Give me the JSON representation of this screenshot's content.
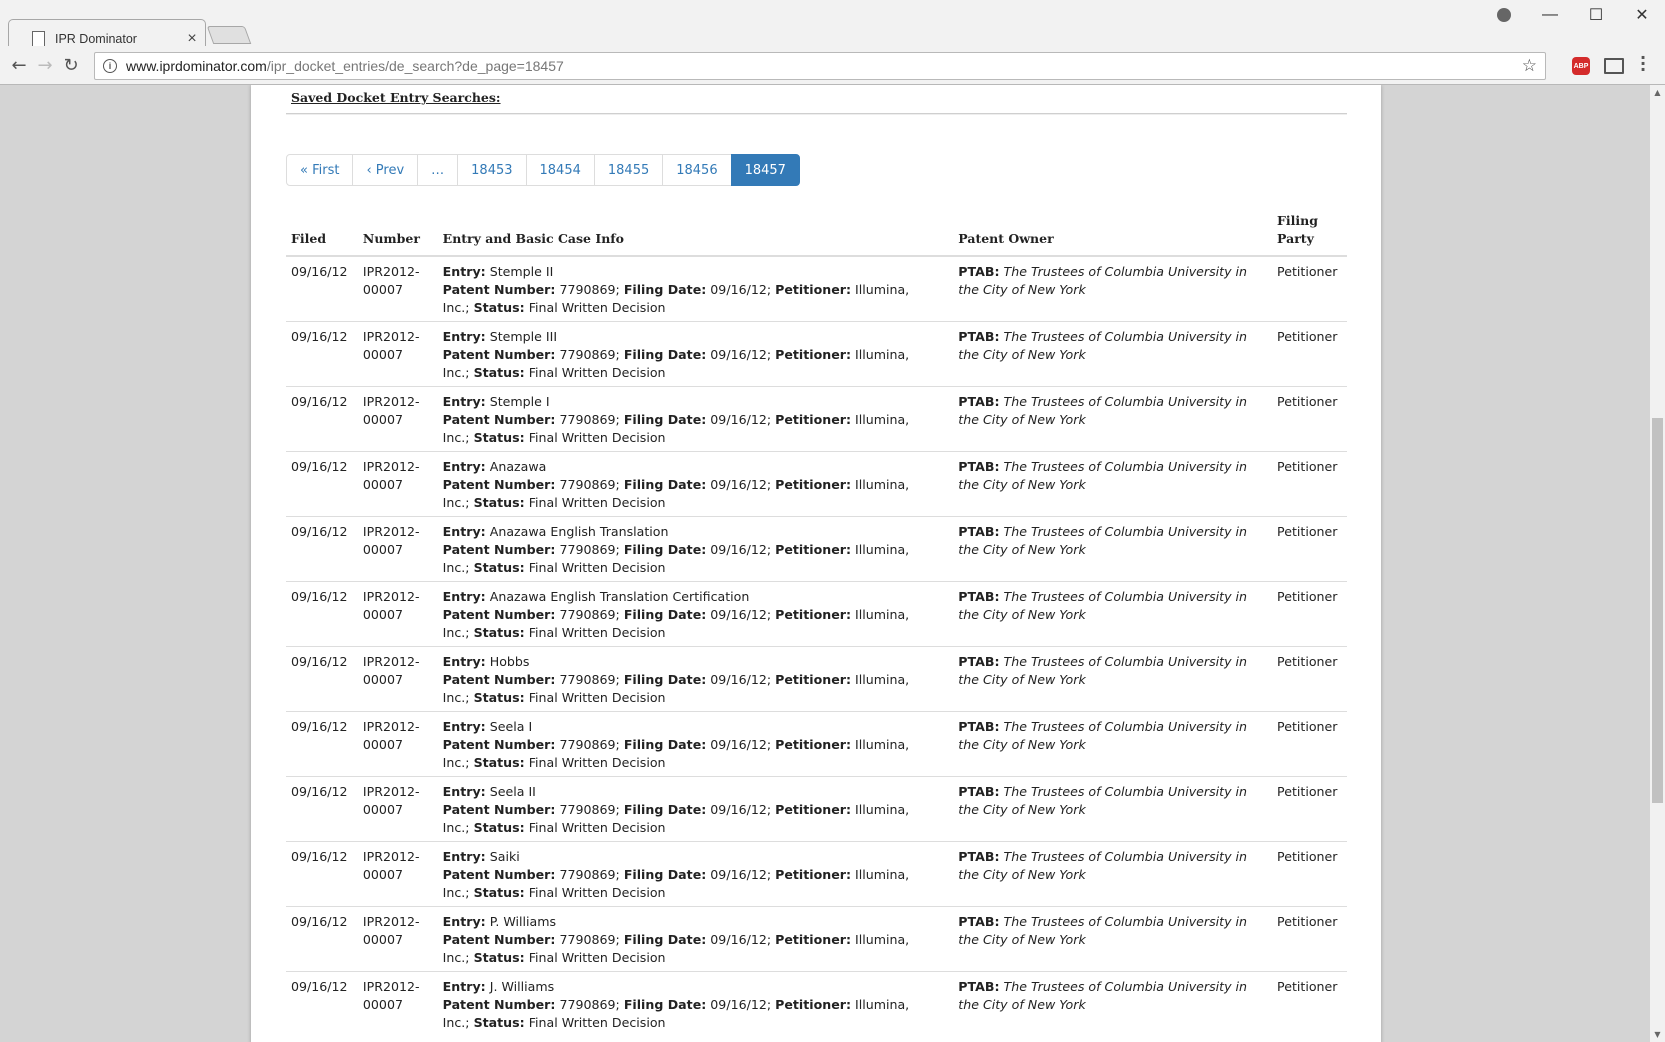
{
  "browser": {
    "tab_title": "IPR Dominator",
    "url_host": "www.iprdominator.com",
    "url_path": "/ipr_docket_entries/de_search?de_page=18457",
    "abp_label": "ABP"
  },
  "page": {
    "saved_searches_label": "Saved Docket Entry Searches:",
    "pagination": [
      "« First",
      "‹ Prev",
      "…",
      "18453",
      "18454",
      "18455",
      "18456",
      "18457"
    ],
    "active_page": "18457",
    "table": {
      "headers": [
        "Filed",
        "Number",
        "Entry and Basic Case Info",
        "Patent Owner",
        "Filing Party"
      ],
      "labels": {
        "entry": "Entry:",
        "patent_number": "Patent Number:",
        "filing_date": "Filing Date:",
        "petitioner": "Petitioner:",
        "status": "Status:",
        "ptab": "PTAB:"
      },
      "rows": [
        {
          "filed": "09/16/12",
          "number_a": "IPR2012-",
          "number_b": "00007",
          "entry": "Stemple II",
          "patent_number": "7790869;",
          "filing_date": "09/16/12;",
          "petitioner_a": "Illumina,",
          "petitioner_b": "Inc.;",
          "status": "Final Written Decision",
          "owner": "The Trustees of Columbia University in the City of New York",
          "party": "Petitioner"
        },
        {
          "filed": "09/16/12",
          "number_a": "IPR2012-",
          "number_b": "00007",
          "entry": "Stemple III",
          "patent_number": "7790869;",
          "filing_date": "09/16/12;",
          "petitioner_a": "Illumina,",
          "petitioner_b": "Inc.;",
          "status": "Final Written Decision",
          "owner": "The Trustees of Columbia University in the City of New York",
          "party": "Petitioner"
        },
        {
          "filed": "09/16/12",
          "number_a": "IPR2012-",
          "number_b": "00007",
          "entry": "Stemple I",
          "patent_number": "7790869;",
          "filing_date": "09/16/12;",
          "petitioner_a": "Illumina,",
          "petitioner_b": "Inc.;",
          "status": "Final Written Decision",
          "owner": "The Trustees of Columbia University in the City of New York",
          "party": "Petitioner"
        },
        {
          "filed": "09/16/12",
          "number_a": "IPR2012-",
          "number_b": "00007",
          "entry": "Anazawa",
          "patent_number": "7790869;",
          "filing_date": "09/16/12;",
          "petitioner_a": "Illumina,",
          "petitioner_b": "Inc.;",
          "status": "Final Written Decision",
          "owner": "The Trustees of Columbia University in the City of New York",
          "party": "Petitioner"
        },
        {
          "filed": "09/16/12",
          "number_a": "IPR2012-",
          "number_b": "00007",
          "entry": "Anazawa English Translation",
          "patent_number": "7790869;",
          "filing_date": "09/16/12;",
          "petitioner_a": "Illumina,",
          "petitioner_b": "Inc.;",
          "status": "Final Written Decision",
          "owner": "The Trustees of Columbia University in the City of New York",
          "party": "Petitioner"
        },
        {
          "filed": "09/16/12",
          "number_a": "IPR2012-",
          "number_b": "00007",
          "entry": "Anazawa English Translation Certification",
          "patent_number": "7790869;",
          "filing_date": "09/16/12;",
          "petitioner_a": "Illumina,",
          "petitioner_b": "Inc.;",
          "status": "Final Written Decision",
          "owner": "The Trustees of Columbia University in the City of New York",
          "party": "Petitioner"
        },
        {
          "filed": "09/16/12",
          "number_a": "IPR2012-",
          "number_b": "00007",
          "entry": "Hobbs",
          "patent_number": "7790869;",
          "filing_date": "09/16/12;",
          "petitioner_a": "Illumina,",
          "petitioner_b": "Inc.;",
          "status": "Final Written Decision",
          "owner": "The Trustees of Columbia University in the City of New York",
          "party": "Petitioner"
        },
        {
          "filed": "09/16/12",
          "number_a": "IPR2012-",
          "number_b": "00007",
          "entry": "Seela I",
          "patent_number": "7790869;",
          "filing_date": "09/16/12;",
          "petitioner_a": "Illumina,",
          "petitioner_b": "Inc.;",
          "status": "Final Written Decision",
          "owner": "The Trustees of Columbia University in the City of New York",
          "party": "Petitioner"
        },
        {
          "filed": "09/16/12",
          "number_a": "IPR2012-",
          "number_b": "00007",
          "entry": "Seela II",
          "patent_number": "7790869;",
          "filing_date": "09/16/12;",
          "petitioner_a": "Illumina,",
          "petitioner_b": "Inc.;",
          "status": "Final Written Decision",
          "owner": "The Trustees of Columbia University in the City of New York",
          "party": "Petitioner"
        },
        {
          "filed": "09/16/12",
          "number_a": "IPR2012-",
          "number_b": "00007",
          "entry": "Saiki",
          "patent_number": "7790869;",
          "filing_date": "09/16/12;",
          "petitioner_a": "Illumina,",
          "petitioner_b": "Inc.;",
          "status": "Final Written Decision",
          "owner": "The Trustees of Columbia University in the City of New York",
          "party": "Petitioner"
        },
        {
          "filed": "09/16/12",
          "number_a": "IPR2012-",
          "number_b": "00007",
          "entry": "P. Williams",
          "patent_number": "7790869;",
          "filing_date": "09/16/12;",
          "petitioner_a": "Illumina,",
          "petitioner_b": "Inc.;",
          "status": "Final Written Decision",
          "owner": "The Trustees of Columbia University in the City of New York",
          "party": "Petitioner"
        },
        {
          "filed": "09/16/12",
          "number_a": "IPR2012-",
          "number_b": "00007",
          "entry": "J. Williams",
          "patent_number": "7790869;",
          "filing_date": "09/16/12;",
          "petitioner_a": "Illumina,",
          "petitioner_b": "Inc.;",
          "status": "Final Written Decision",
          "owner": "The Trustees of Columbia University in the City of New York",
          "party": "Petitioner"
        }
      ]
    }
  }
}
